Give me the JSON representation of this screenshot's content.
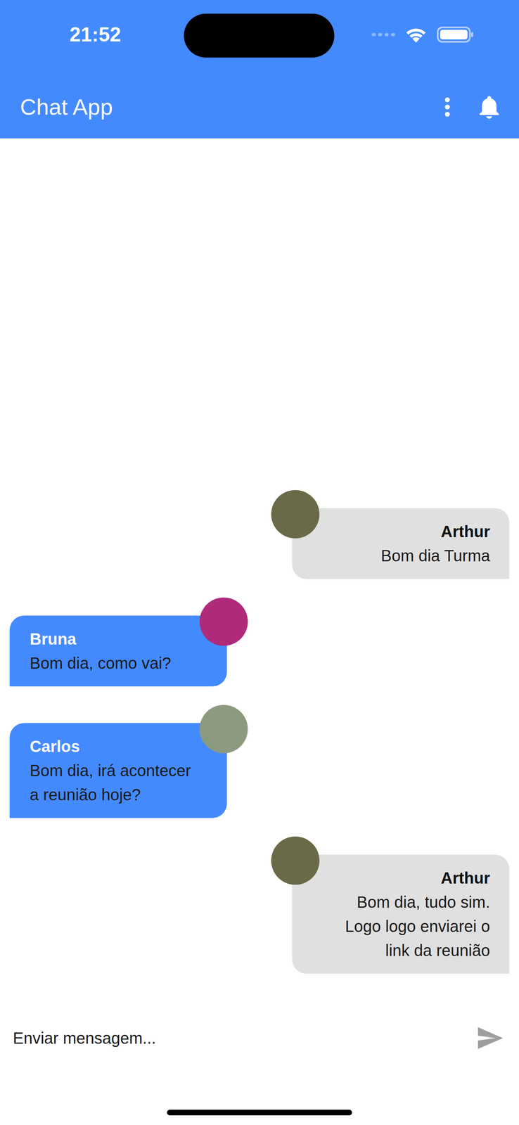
{
  "status_bar": {
    "time": "21:52"
  },
  "app_bar": {
    "title": "Chat App"
  },
  "messages": [
    {
      "author": "Arthur",
      "text": "Bom dia Turma",
      "kind": "sent",
      "color": "#6b6a48"
    },
    {
      "author": "Bruna",
      "text": "Bom dia, como vai?",
      "kind": "received",
      "color": "#b02a7c"
    },
    {
      "author": "Carlos",
      "text": "Bom dia, irá acontecer a reunião hoje?",
      "kind": "received",
      "color": "#8c9a80"
    },
    {
      "author": "Arthur",
      "text": "Bom dia, tudo sim. Logo logo enviarei o link da reunião",
      "kind": "sent",
      "color": "#6b6a48"
    }
  ],
  "composer": {
    "placeholder": "Enviar mensagem..."
  }
}
